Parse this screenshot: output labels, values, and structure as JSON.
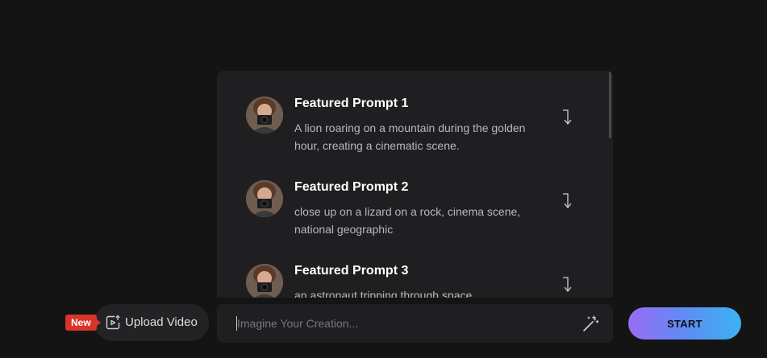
{
  "featured_prompts": [
    {
      "title": "Featured Prompt 1",
      "description": "A lion roaring on a mountain during the golden hour, creating a cinematic scene.",
      "avatar_icon": "photographer-avatar",
      "action_icon": "insert-arrow-icon"
    },
    {
      "title": "Featured Prompt 2",
      "description": "close up on a lizard on a rock, cinema scene, national geographic",
      "avatar_icon": "photographer-avatar",
      "action_icon": "insert-arrow-icon"
    },
    {
      "title": "Featured Prompt 3",
      "description": "an astronaut tripping through space",
      "avatar_icon": "photographer-avatar",
      "action_icon": "insert-arrow-icon"
    }
  ],
  "toolbar": {
    "new_badge": "New",
    "upload_label": "Upload Video",
    "upload_icon": "video-upload-icon",
    "prompt_value": "",
    "prompt_placeholder": "Imagine Your Creation...",
    "magic_icon": "magic-wand-icon",
    "start_label": "START"
  },
  "colors": {
    "background": "#141415",
    "panel": "#1f1f22",
    "badge": "#d8342a",
    "start_gradient_from": "#9a6cf6",
    "start_gradient_to": "#3bb3f1"
  }
}
